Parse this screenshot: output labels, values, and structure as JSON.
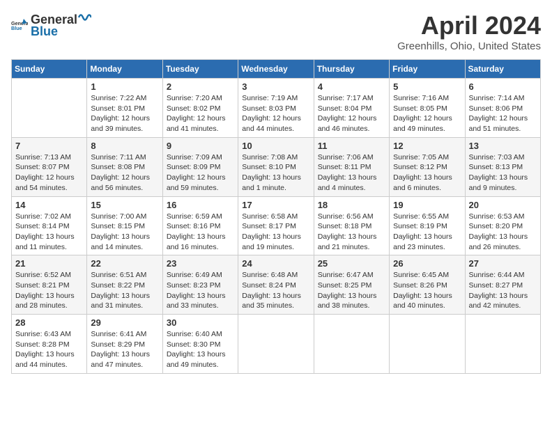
{
  "header": {
    "logo_general": "General",
    "logo_blue": "Blue",
    "month_title": "April 2024",
    "location": "Greenhills, Ohio, United States"
  },
  "days_of_week": [
    "Sunday",
    "Monday",
    "Tuesday",
    "Wednesday",
    "Thursday",
    "Friday",
    "Saturday"
  ],
  "weeks": [
    [
      {
        "day": "",
        "info": ""
      },
      {
        "day": "1",
        "info": "Sunrise: 7:22 AM\nSunset: 8:01 PM\nDaylight: 12 hours\nand 39 minutes."
      },
      {
        "day": "2",
        "info": "Sunrise: 7:20 AM\nSunset: 8:02 PM\nDaylight: 12 hours\nand 41 minutes."
      },
      {
        "day": "3",
        "info": "Sunrise: 7:19 AM\nSunset: 8:03 PM\nDaylight: 12 hours\nand 44 minutes."
      },
      {
        "day": "4",
        "info": "Sunrise: 7:17 AM\nSunset: 8:04 PM\nDaylight: 12 hours\nand 46 minutes."
      },
      {
        "day": "5",
        "info": "Sunrise: 7:16 AM\nSunset: 8:05 PM\nDaylight: 12 hours\nand 49 minutes."
      },
      {
        "day": "6",
        "info": "Sunrise: 7:14 AM\nSunset: 8:06 PM\nDaylight: 12 hours\nand 51 minutes."
      }
    ],
    [
      {
        "day": "7",
        "info": "Sunrise: 7:13 AM\nSunset: 8:07 PM\nDaylight: 12 hours\nand 54 minutes."
      },
      {
        "day": "8",
        "info": "Sunrise: 7:11 AM\nSunset: 8:08 PM\nDaylight: 12 hours\nand 56 minutes."
      },
      {
        "day": "9",
        "info": "Sunrise: 7:09 AM\nSunset: 8:09 PM\nDaylight: 12 hours\nand 59 minutes."
      },
      {
        "day": "10",
        "info": "Sunrise: 7:08 AM\nSunset: 8:10 PM\nDaylight: 13 hours\nand 1 minute."
      },
      {
        "day": "11",
        "info": "Sunrise: 7:06 AM\nSunset: 8:11 PM\nDaylight: 13 hours\nand 4 minutes."
      },
      {
        "day": "12",
        "info": "Sunrise: 7:05 AM\nSunset: 8:12 PM\nDaylight: 13 hours\nand 6 minutes."
      },
      {
        "day": "13",
        "info": "Sunrise: 7:03 AM\nSunset: 8:13 PM\nDaylight: 13 hours\nand 9 minutes."
      }
    ],
    [
      {
        "day": "14",
        "info": "Sunrise: 7:02 AM\nSunset: 8:14 PM\nDaylight: 13 hours\nand 11 minutes."
      },
      {
        "day": "15",
        "info": "Sunrise: 7:00 AM\nSunset: 8:15 PM\nDaylight: 13 hours\nand 14 minutes."
      },
      {
        "day": "16",
        "info": "Sunrise: 6:59 AM\nSunset: 8:16 PM\nDaylight: 13 hours\nand 16 minutes."
      },
      {
        "day": "17",
        "info": "Sunrise: 6:58 AM\nSunset: 8:17 PM\nDaylight: 13 hours\nand 19 minutes."
      },
      {
        "day": "18",
        "info": "Sunrise: 6:56 AM\nSunset: 8:18 PM\nDaylight: 13 hours\nand 21 minutes."
      },
      {
        "day": "19",
        "info": "Sunrise: 6:55 AM\nSunset: 8:19 PM\nDaylight: 13 hours\nand 23 minutes."
      },
      {
        "day": "20",
        "info": "Sunrise: 6:53 AM\nSunset: 8:20 PM\nDaylight: 13 hours\nand 26 minutes."
      }
    ],
    [
      {
        "day": "21",
        "info": "Sunrise: 6:52 AM\nSunset: 8:21 PM\nDaylight: 13 hours\nand 28 minutes."
      },
      {
        "day": "22",
        "info": "Sunrise: 6:51 AM\nSunset: 8:22 PM\nDaylight: 13 hours\nand 31 minutes."
      },
      {
        "day": "23",
        "info": "Sunrise: 6:49 AM\nSunset: 8:23 PM\nDaylight: 13 hours\nand 33 minutes."
      },
      {
        "day": "24",
        "info": "Sunrise: 6:48 AM\nSunset: 8:24 PM\nDaylight: 13 hours\nand 35 minutes."
      },
      {
        "day": "25",
        "info": "Sunrise: 6:47 AM\nSunset: 8:25 PM\nDaylight: 13 hours\nand 38 minutes."
      },
      {
        "day": "26",
        "info": "Sunrise: 6:45 AM\nSunset: 8:26 PM\nDaylight: 13 hours\nand 40 minutes."
      },
      {
        "day": "27",
        "info": "Sunrise: 6:44 AM\nSunset: 8:27 PM\nDaylight: 13 hours\nand 42 minutes."
      }
    ],
    [
      {
        "day": "28",
        "info": "Sunrise: 6:43 AM\nSunset: 8:28 PM\nDaylight: 13 hours\nand 44 minutes."
      },
      {
        "day": "29",
        "info": "Sunrise: 6:41 AM\nSunset: 8:29 PM\nDaylight: 13 hours\nand 47 minutes."
      },
      {
        "day": "30",
        "info": "Sunrise: 6:40 AM\nSunset: 8:30 PM\nDaylight: 13 hours\nand 49 minutes."
      },
      {
        "day": "",
        "info": ""
      },
      {
        "day": "",
        "info": ""
      },
      {
        "day": "",
        "info": ""
      },
      {
        "day": "",
        "info": ""
      }
    ]
  ]
}
